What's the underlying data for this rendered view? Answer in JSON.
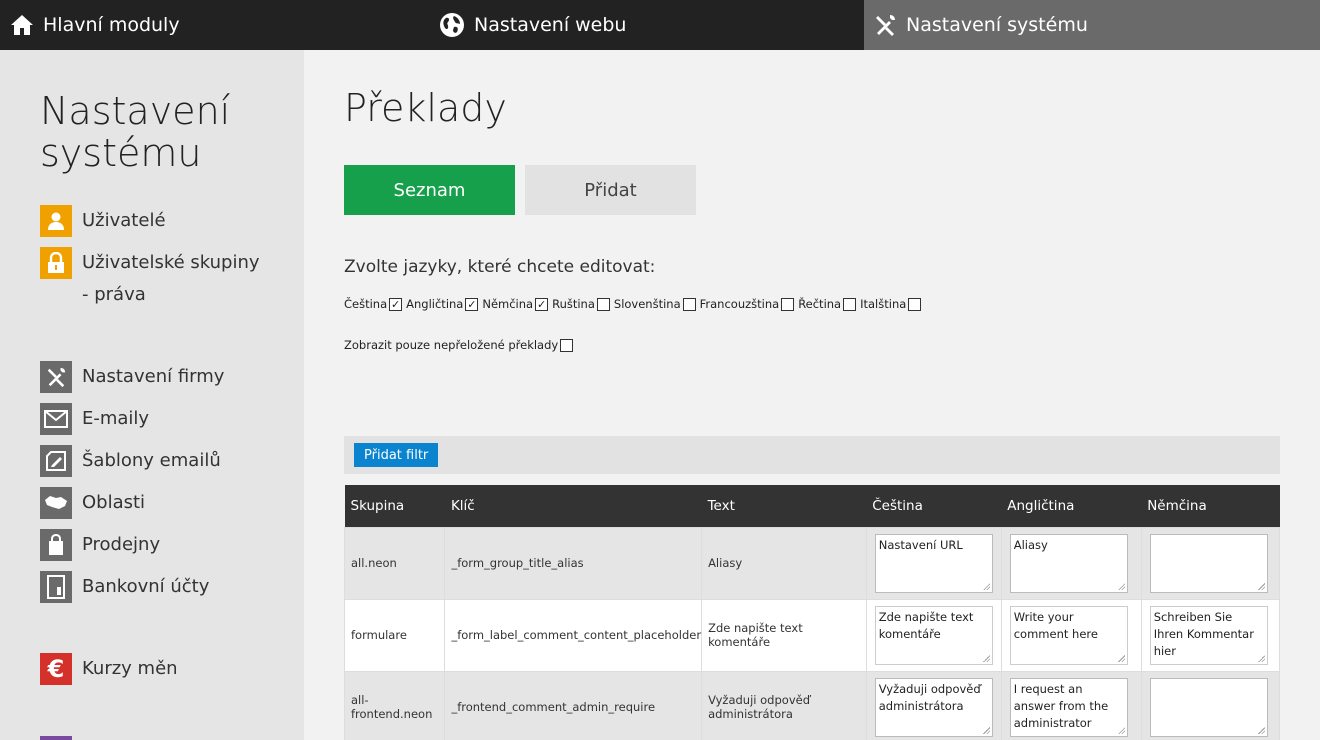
{
  "topnav": [
    {
      "label": "Hlavní moduly",
      "icon": "home-icon"
    },
    {
      "label": "Nastavení webu",
      "icon": "globe-icon"
    },
    {
      "label": "Nastavení systému",
      "icon": "tools-icon"
    }
  ],
  "sidebar": {
    "title": "Nastavení systému",
    "items": [
      {
        "label": "Uživatelé",
        "icon": "user-icon",
        "color": "#f0a100"
      },
      {
        "label": "Uživatelské skupiny - práva",
        "icon": "lock-icon",
        "color": "#f0a100"
      },
      {
        "label": "Nastavení firmy",
        "icon": "tools-icon",
        "color": "#6a6a6a"
      },
      {
        "label": "E-maily",
        "icon": "envelope-icon",
        "color": "#6a6a6a"
      },
      {
        "label": "Šablony emailů",
        "icon": "template-icon",
        "color": "#6a6a6a"
      },
      {
        "label": "Oblasti",
        "icon": "map-icon",
        "color": "#6a6a6a"
      },
      {
        "label": "Prodejny",
        "icon": "shopping-bag-icon",
        "color": "#6a6a6a"
      },
      {
        "label": "Bankovní účty",
        "icon": "bank-icon",
        "color": "#6a6a6a"
      },
      {
        "label": "Kurzy měn",
        "icon": "euro-icon",
        "color": "#d4312a"
      }
    ]
  },
  "main": {
    "title": "Překlady",
    "tabs": {
      "list": "Seznam",
      "add": "Přidat"
    },
    "lang_prompt": "Zvolte jazyky, které chcete editovat:",
    "languages": [
      {
        "label": "Čeština",
        "checked": true
      },
      {
        "label": "Angličtina",
        "checked": true
      },
      {
        "label": "Němčina",
        "checked": true
      },
      {
        "label": "Ruština",
        "checked": false
      },
      {
        "label": "Slovenština",
        "checked": false
      },
      {
        "label": "Francouzština",
        "checked": false
      },
      {
        "label": "Řečtina",
        "checked": false
      },
      {
        "label": "Italština",
        "checked": false
      }
    ],
    "untranslated_only": {
      "label": "Zobrazit pouze nepřeložené překlady",
      "checked": false
    },
    "filter_button": "Přidat filtr"
  },
  "table": {
    "headers": [
      "Skupina",
      "Klíč",
      "Text",
      "Čeština",
      "Angličtina",
      "Němčina"
    ],
    "rows": [
      {
        "group": "all.neon",
        "key": "_form_group_title_alias",
        "text": "Aliasy",
        "cs": "Nastavení URL",
        "en": "Aliasy",
        "de": ""
      },
      {
        "group": "formulare",
        "key": "_form_label_comment_content_placeholder",
        "text": "Zde napište text komentáře",
        "cs": "Zde napište text komentáře",
        "en": "Write your comment here",
        "de": "Schreiben Sie Ihren Kommentar hier"
      },
      {
        "group": "all-frontend.neon",
        "key": "_frontend_comment_admin_require",
        "text": "Vyžaduji odpověď administrátora",
        "cs": "Vyžaduji odpověď administrátora",
        "en": "I request an answer from the administrator",
        "de": ""
      }
    ]
  },
  "colors": {
    "accent_green": "#16a04c",
    "filter_blue": "#0a84cf",
    "topbar": "#222222",
    "active_tab": "#6a6a6a",
    "orange": "#f0a100",
    "red": "#d4312a"
  }
}
